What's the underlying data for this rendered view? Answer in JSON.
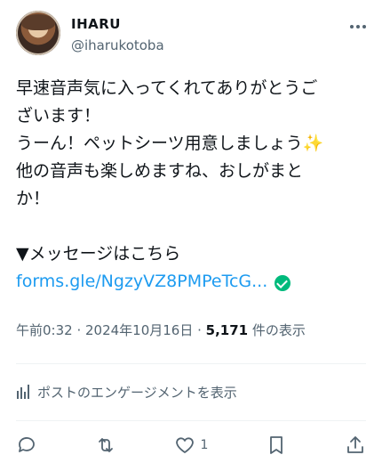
{
  "author": {
    "name": "IHARU",
    "handle": "@iharukotoba"
  },
  "tweet": {
    "line1": "早速音声気に入ってくれてありがとうご",
    "line2": "ざいます！",
    "line3_text": "うーん！ペットシーツ用意しましょう",
    "line3_emoji": "✨",
    "line4": "他の音声も楽しめますね、おしがまと",
    "line5": "か！",
    "line6": "",
    "line7": "▼メッセージはこちら",
    "link_text": "forms.gle/NgzyVZ8PMPeTcG..."
  },
  "meta": {
    "time_date": "午前0:32 · 2024年10月16日 · ",
    "views_count": "5,171",
    "views_label": " 件の表示"
  },
  "engagement": {
    "label": "ポストのエンゲージメントを表示"
  },
  "actions": {
    "like_count": "1"
  },
  "colors": {
    "link": "#1d9bf0",
    "verified": "#00ba7c",
    "muted": "#536471",
    "text": "#0f1419"
  }
}
